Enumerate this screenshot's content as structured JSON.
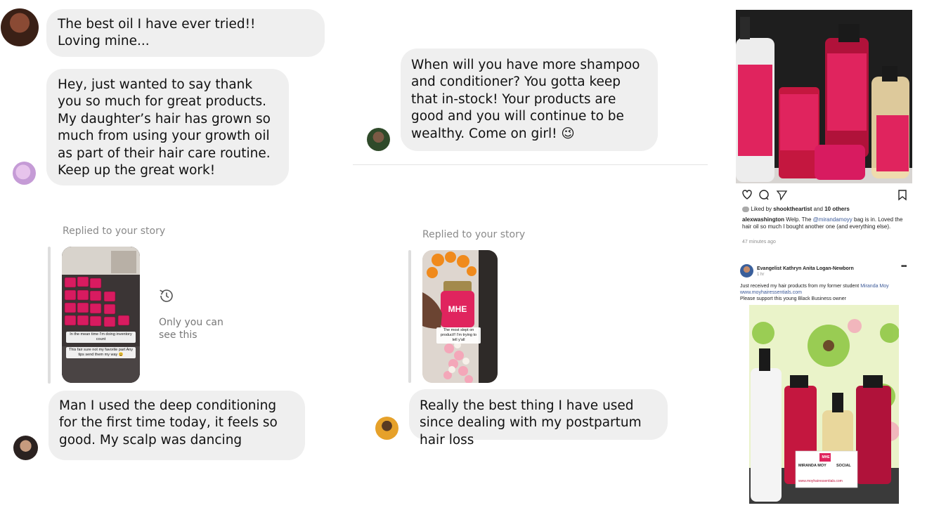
{
  "messages": {
    "m1": "The best oil I have ever tried!! Loving mine...",
    "m2": "Hey, just wanted to say thank you so much for great products. My daughter’s hair has grown so much from using your growth oil as part of their hair care routine. Keep up the great work!",
    "m3": "When will you have more shampoo and conditioner? You gotta keep that in-stock! Your products are good and you will continue to be wealthy. Come on girl! 😉",
    "m4": "Man I used the deep conditioning for the first time today, it feels so good. My scalp was dancing",
    "m5": "Really the best thing I have used since dealing with my postpartum hair loss"
  },
  "story_reply_left": {
    "label": "Replied to your story",
    "caption_1": "In the mean time I'm doing inventory count",
    "caption_2": "This fair sure not my favorite part Any tips send them my way 😩",
    "restricted_text": "Only you can see this"
  },
  "story_reply_right": {
    "label": "Replied to your story",
    "caption": "The most slept on product!! I'm trying to tell y'all"
  },
  "instagram_post": {
    "liked_by_prefix": "Liked by",
    "liked_by_user": "shooktheartist",
    "liked_by_and": "and",
    "liked_by_others": "10 others",
    "comment_user": "alexwashington",
    "comment_text_1": "Welp. The",
    "comment_mention": "@mirandamoyy",
    "comment_text_2": "bag is in. Loved the hair oil so much I bought another one (and everything else).",
    "timestamp": "47 minutes ago",
    "brand_mark": "MHE"
  },
  "facebook_post": {
    "author": "Evangelist Kathryn Anita Logan-Newborn",
    "time": "1 hr",
    "text_1": "Just received my hair products from my former student",
    "mention": "Miranda Moy",
    "url": "www.moyhairessentials.com",
    "text_2": "Please support this young Black Business owner",
    "card_name": "MIRANDA MOY",
    "card_social": "SOCIAL",
    "card_url": "www.moyhairessentials.com",
    "brand_mark": "MHE"
  },
  "colors": {
    "bubble": "#efefef",
    "brand_pink": "#e0245e",
    "link": "#3b5998"
  }
}
